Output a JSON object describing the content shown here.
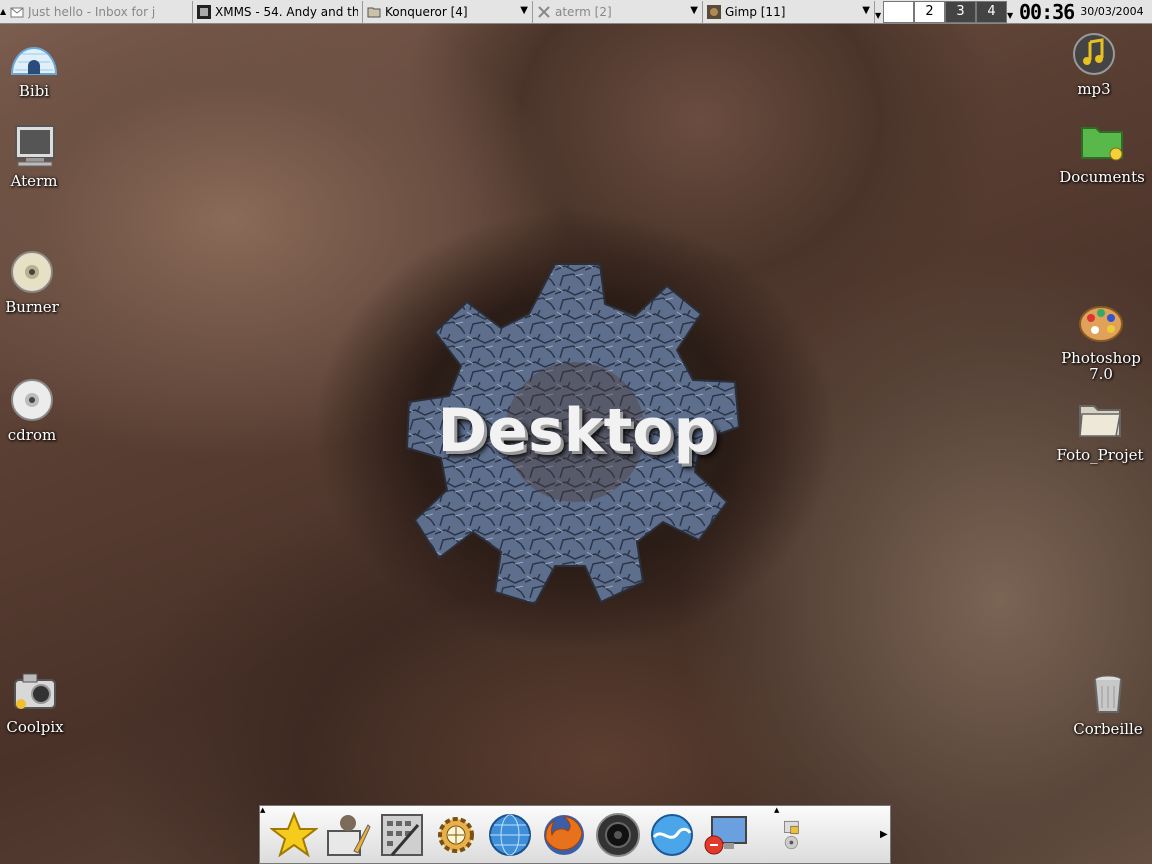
{
  "taskbar": {
    "tasks": [
      {
        "label": "Just hello - Inbox for j",
        "icon": "mail-icon",
        "active": false
      },
      {
        "label": "XMMS - 54. Andy and th",
        "icon": "xmms-icon",
        "active": true
      },
      {
        "label": "Konqueror [4]",
        "icon": "folder-icon",
        "active": true
      },
      {
        "label": "aterm [2]",
        "icon": "x-icon",
        "active": false
      },
      {
        "label": "Gimp [11]",
        "icon": "gimp-icon",
        "active": true
      }
    ],
    "desktops": [
      "",
      "2",
      "3",
      "4"
    ],
    "clock": "00:36",
    "date": "30/03/2004"
  },
  "desktop": {
    "title": "Desktop",
    "left_icons": [
      {
        "label": "Bibi",
        "icon": "igloo-home-icon"
      },
      {
        "label": "Aterm",
        "icon": "terminal-icon"
      },
      {
        "label": "Burner",
        "icon": "cd-burner-icon"
      },
      {
        "label": "cdrom",
        "icon": "cdrom-icon"
      },
      {
        "label": "Coolpix",
        "icon": "camera-icon"
      }
    ],
    "right_icons": [
      {
        "label": "mp3",
        "icon": "music-note-icon"
      },
      {
        "label": "Documents",
        "icon": "green-folder-icon"
      },
      {
        "label": "Photoshop 7.0",
        "icon": "palette-icon"
      },
      {
        "label": "Foto_Projet",
        "icon": "folder-icon"
      },
      {
        "label": "Corbeille",
        "icon": "trash-icon"
      }
    ]
  },
  "dock": {
    "apps": [
      {
        "icon": "star-icon"
      },
      {
        "icon": "editor-icon"
      },
      {
        "icon": "calculator-icon"
      },
      {
        "icon": "web-gear-icon"
      },
      {
        "icon": "blue-globe-icon"
      },
      {
        "icon": "firefox-icon"
      },
      {
        "icon": "speaker-icon"
      },
      {
        "icon": "wave-icon"
      },
      {
        "icon": "monitor-icon"
      },
      {
        "icon": "tray-icon"
      }
    ]
  },
  "colors": {
    "accent_blue": "#5b7fb0",
    "rock": "#6e5244"
  }
}
